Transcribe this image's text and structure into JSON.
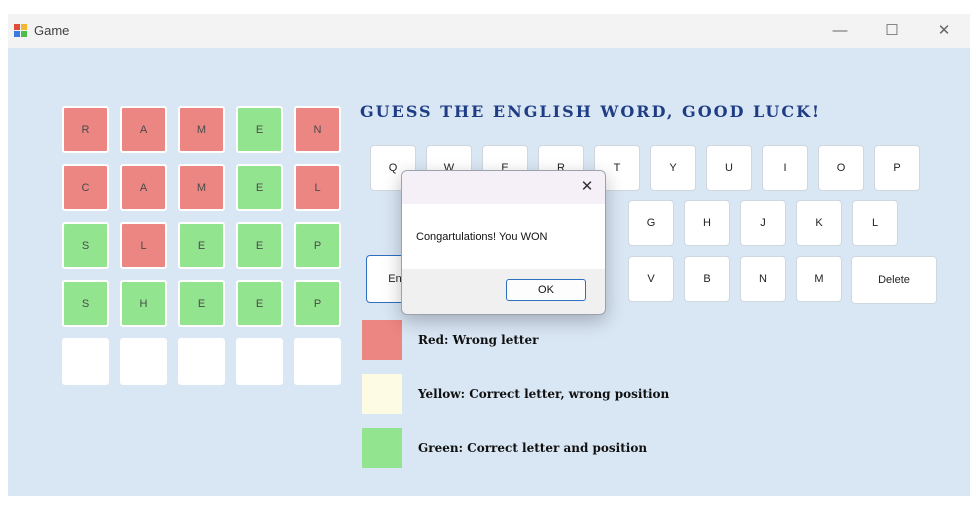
{
  "window": {
    "title": "Game",
    "minimize_glyph": "—",
    "maximize_glyph": "☐",
    "close_glyph": "✕"
  },
  "grid": {
    "rows": [
      [
        {
          "letter": "R",
          "state": "red"
        },
        {
          "letter": "A",
          "state": "red"
        },
        {
          "letter": "M",
          "state": "red"
        },
        {
          "letter": "E",
          "state": "green"
        },
        {
          "letter": "N",
          "state": "red"
        }
      ],
      [
        {
          "letter": "C",
          "state": "red"
        },
        {
          "letter": "A",
          "state": "red"
        },
        {
          "letter": "M",
          "state": "red"
        },
        {
          "letter": "E",
          "state": "green"
        },
        {
          "letter": "L",
          "state": "red"
        }
      ],
      [
        {
          "letter": "S",
          "state": "green"
        },
        {
          "letter": "L",
          "state": "red"
        },
        {
          "letter": "E",
          "state": "green"
        },
        {
          "letter": "E",
          "state": "green"
        },
        {
          "letter": "P",
          "state": "green"
        }
      ],
      [
        {
          "letter": "S",
          "state": "green"
        },
        {
          "letter": "H",
          "state": "green"
        },
        {
          "letter": "E",
          "state": "green"
        },
        {
          "letter": "E",
          "state": "green"
        },
        {
          "letter": "P",
          "state": "green"
        }
      ],
      [
        {
          "letter": "",
          "state": "empty"
        },
        {
          "letter": "",
          "state": "empty"
        },
        {
          "letter": "",
          "state": "empty"
        },
        {
          "letter": "",
          "state": "empty"
        },
        {
          "letter": "",
          "state": "empty"
        }
      ]
    ]
  },
  "heading": "GUESS THE ENGLISH WORD, GOOD LUCK!",
  "keyboard": {
    "row1": [
      "Q",
      "W",
      "E",
      "R",
      "T",
      "Y",
      "U",
      "I",
      "O",
      "P"
    ],
    "row2": [
      "G",
      "H",
      "J",
      "K",
      "L"
    ],
    "row3": [
      "V",
      "B",
      "N",
      "M"
    ],
    "enter_label": "En",
    "delete_label": "Delete"
  },
  "legend": [
    {
      "color": "#ec8682",
      "text": "Red: Wrong letter"
    },
    {
      "color": "#fdfbe3",
      "text": "Yellow: Correct letter, wrong position"
    },
    {
      "color": "#93e48f",
      "text": "Green: Correct letter and position"
    }
  ],
  "dialog": {
    "message": "Congartulations! You WON",
    "ok_label": "OK",
    "close_glyph": "✕"
  }
}
